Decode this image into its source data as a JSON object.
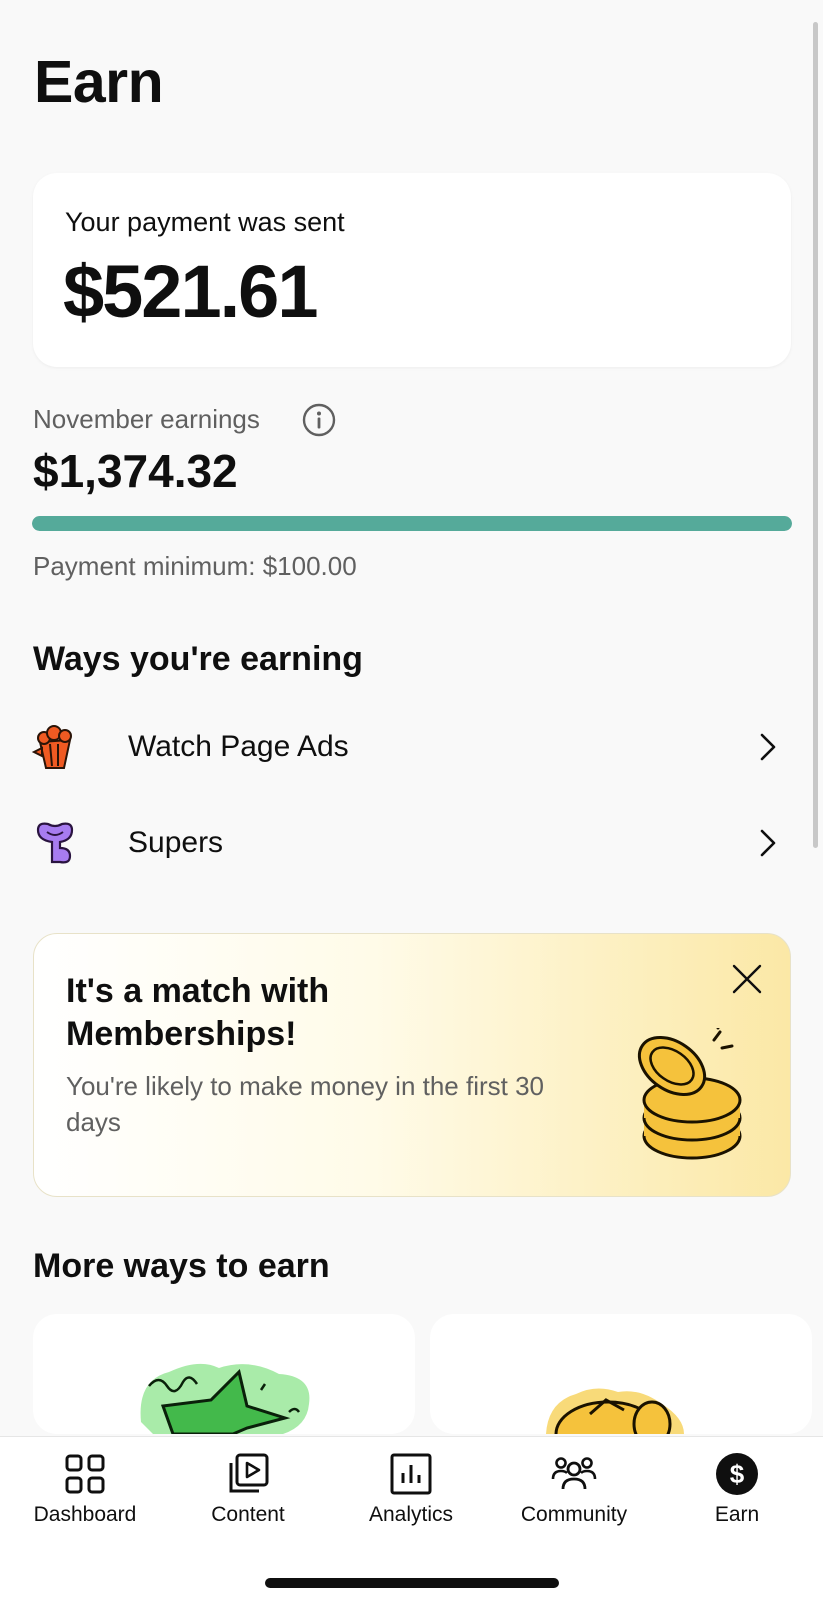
{
  "header": {
    "title": "Earn"
  },
  "payment": {
    "label": "Your payment was sent",
    "amount": "$521.61"
  },
  "earnings": {
    "month_label": "November earnings",
    "amount": "$1,374.32",
    "progress_percent": 100,
    "progress_color": "#55aa9a",
    "minimum_label": "Payment minimum: $100.00"
  },
  "ways": {
    "title": "Ways you're earning",
    "items": [
      {
        "label": "Watch Page Ads",
        "icon": "popcorn-icon"
      },
      {
        "label": "Supers",
        "icon": "supers-icon"
      }
    ]
  },
  "promo": {
    "title": "It's a match with Memberships!",
    "text": "You're likely to make money in the first 30 days",
    "icon": "coins-icon"
  },
  "more": {
    "title": "More ways to earn"
  },
  "nav": {
    "items": [
      {
        "label": "Dashboard",
        "icon": "dashboard-icon"
      },
      {
        "label": "Content",
        "icon": "content-icon"
      },
      {
        "label": "Analytics",
        "icon": "analytics-icon"
      },
      {
        "label": "Community",
        "icon": "community-icon"
      },
      {
        "label": "Earn",
        "icon": "earn-dollar-icon",
        "active": true
      }
    ]
  }
}
